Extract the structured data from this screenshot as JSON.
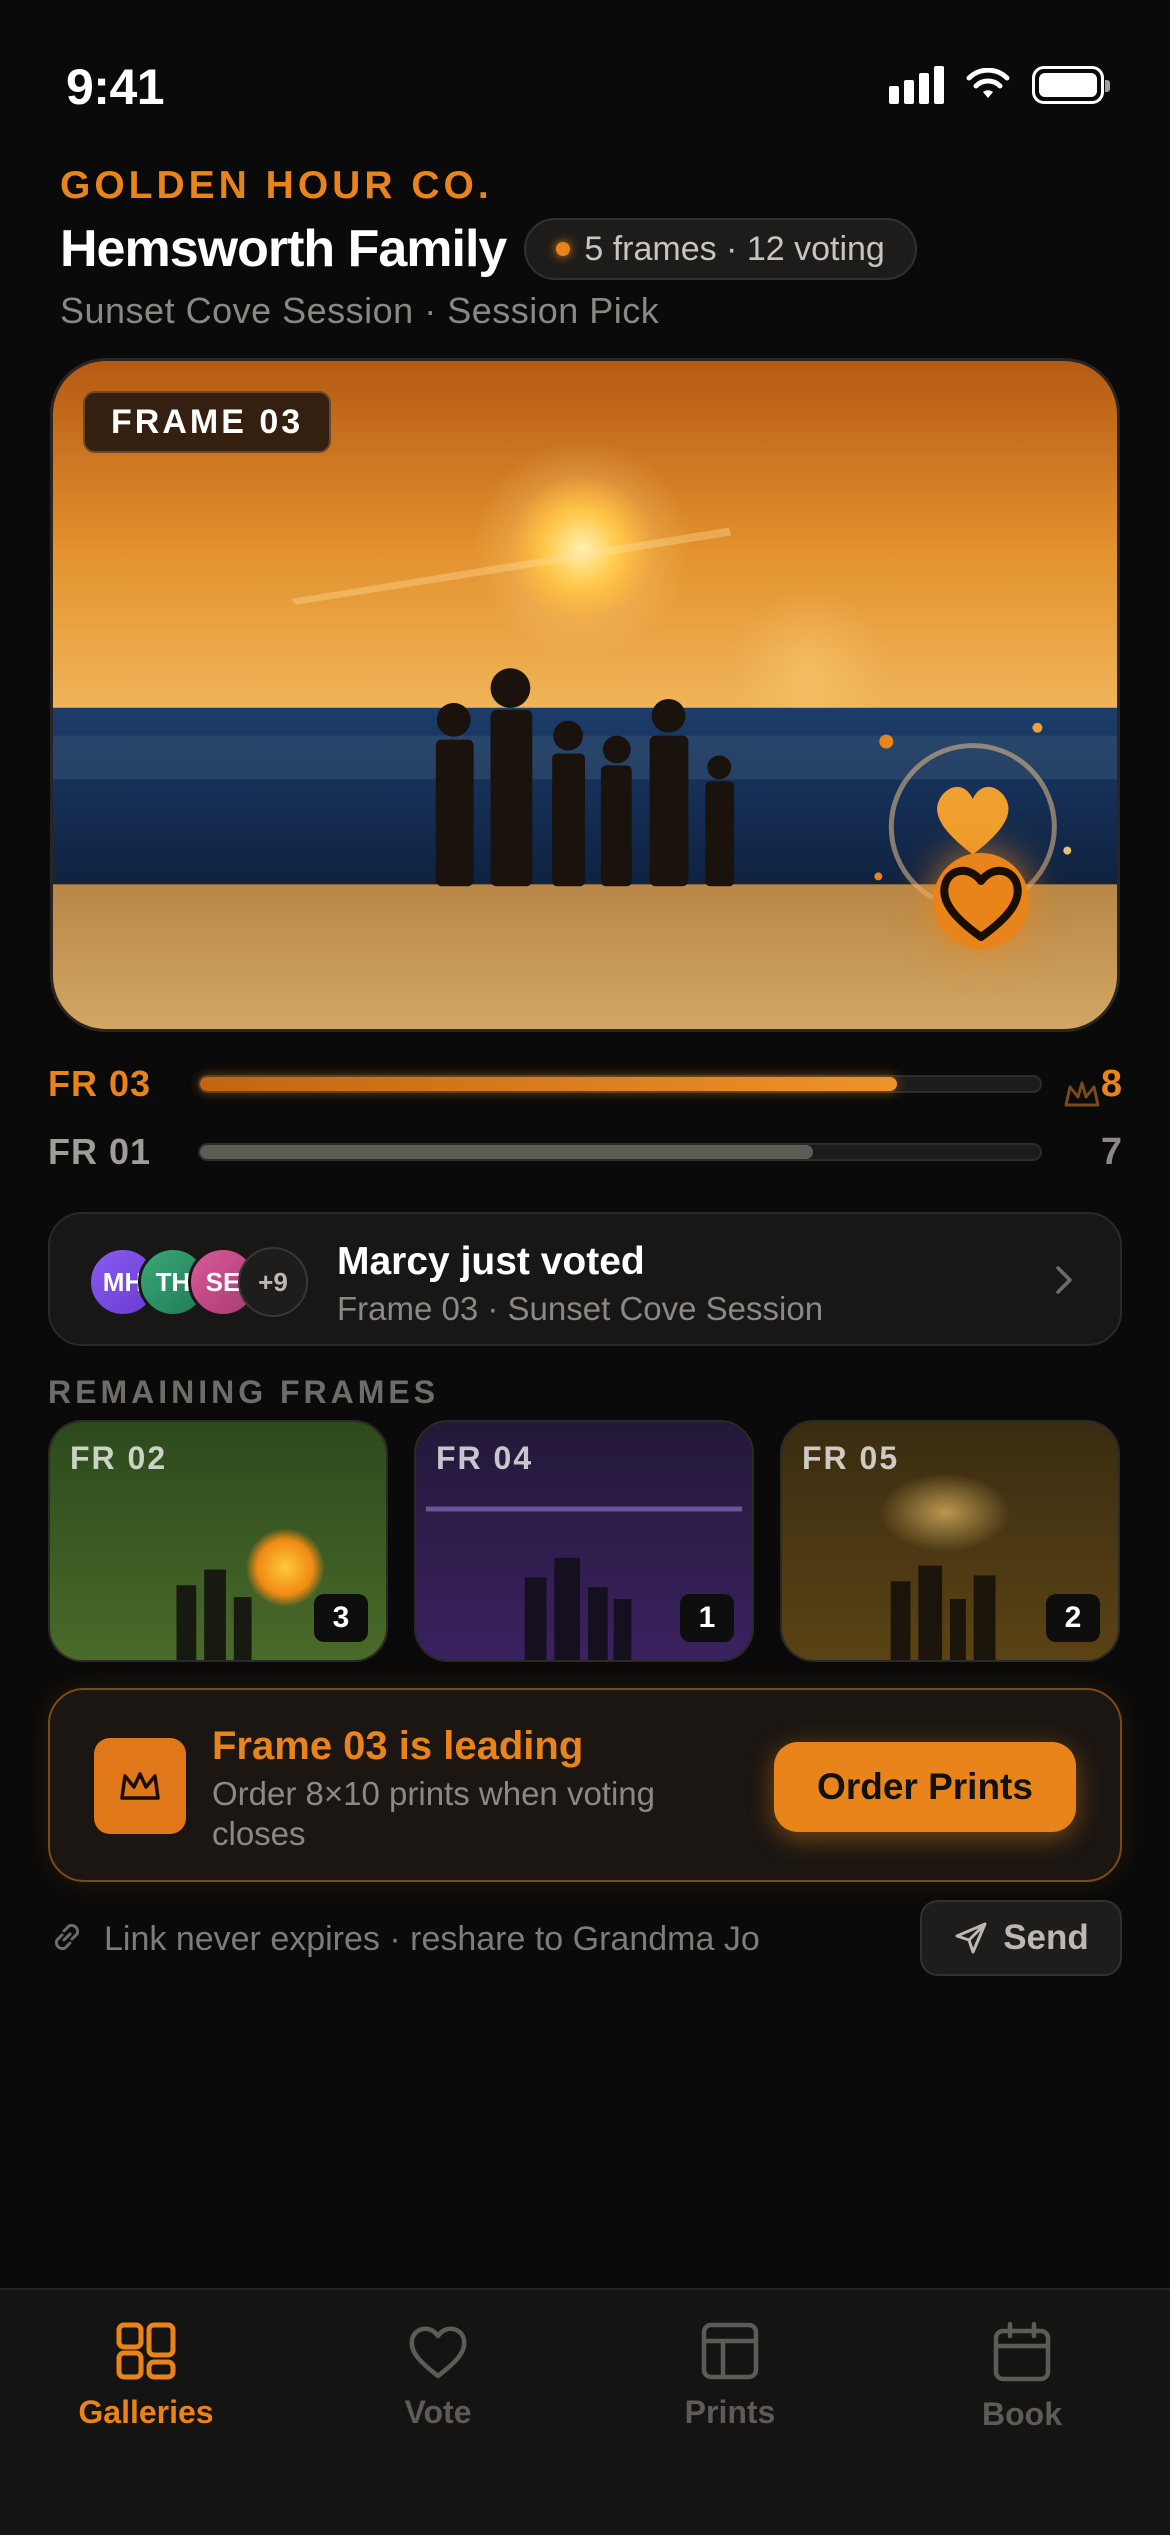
{
  "status_bar": {
    "time": "9:41"
  },
  "header": {
    "brand": "GOLDEN HOUR CO.",
    "family_name": "Hemsworth Family",
    "meta": "5 frames · 12 voting",
    "subtitle": "Sunset Cove Session · Session Pick"
  },
  "hero": {
    "frame_tag": "FRAME 03"
  },
  "scores": [
    {
      "label": "FR 03",
      "value": "8",
      "fraction": 0.83,
      "leading": true
    },
    {
      "label": "FR 01",
      "value": "7",
      "fraction": 0.73,
      "leading": false
    }
  ],
  "activity": {
    "avatars": [
      "MH",
      "TH",
      "SE"
    ],
    "more": "+9",
    "title": "Marcy just voted",
    "subtitle": "Frame 03 · Sunset Cove Session"
  },
  "remaining": {
    "label": "REMAINING FRAMES",
    "frames": [
      {
        "label": "FR 02",
        "count": "3"
      },
      {
        "label": "FR 04",
        "count": "1"
      },
      {
        "label": "FR 05",
        "count": "2"
      }
    ]
  },
  "leading_card": {
    "title": "Frame 03 is leading",
    "subtitle": "Order 8×10 prints when voting closes",
    "button": "Order Prints"
  },
  "share": {
    "text": "Link never expires · reshare to Grandma Jo",
    "send": "Send"
  },
  "tabs": [
    {
      "label": "Galleries",
      "icon": "grid-icon",
      "active": true
    },
    {
      "label": "Vote",
      "icon": "heart-icon",
      "active": false
    },
    {
      "label": "Prints",
      "icon": "layout-icon",
      "active": false
    },
    {
      "label": "Book",
      "icon": "calendar-icon",
      "active": false
    }
  ],
  "colors": {
    "accent": "#e8841a",
    "background": "#0a0a0a"
  }
}
